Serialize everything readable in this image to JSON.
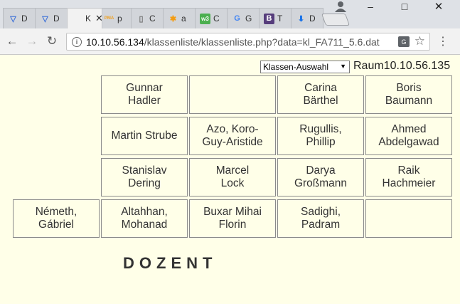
{
  "browser": {
    "tabs": [
      {
        "title": "D",
        "icon": "vpn-icon",
        "color": "#3b6fd8",
        "glyph": "▽"
      },
      {
        "title": "D",
        "icon": "vpn-icon",
        "color": "#3b6fd8",
        "glyph": "▽"
      },
      {
        "title": "K",
        "icon": "page-icon",
        "color": "#777",
        "glyph": "",
        "active": true
      },
      {
        "title": "p",
        "icon": "phpmyadmin-icon",
        "color": "#f0a020",
        "glyph": "PMA"
      },
      {
        "title": "C",
        "icon": "page-icon",
        "color": "#777",
        "glyph": "▯"
      },
      {
        "title": "a",
        "icon": "asterisk-icon",
        "color": "#f39c12",
        "glyph": "✱"
      },
      {
        "title": "C",
        "icon": "w3schools-icon",
        "color": "#4caf50",
        "glyph": "w3"
      },
      {
        "title": "G",
        "icon": "google-icon",
        "color": "#4285f4",
        "glyph": "G"
      },
      {
        "title": "T",
        "icon": "bootstrap-icon",
        "color": "#563d7c",
        "glyph": "B"
      },
      {
        "title": "D",
        "icon": "download-icon",
        "color": "#1a73e8",
        "glyph": "⬇"
      }
    ],
    "url_host": "10.10.56.134",
    "url_path": "/klassenliste/klassenliste.php?data=kl_FA711_5.6.dat"
  },
  "page": {
    "select_value": "Klassen-Auswahl",
    "room_label": "Raum10.10.56.135",
    "dozent_label": "DOZENT",
    "seats": [
      {
        "row": 0,
        "col": 1,
        "name": "Gunnar\nHadler"
      },
      {
        "row": 0,
        "col": 2,
        "name": ""
      },
      {
        "row": 0,
        "col": 3,
        "name": "Carina\nBärthel"
      },
      {
        "row": 0,
        "col": 4,
        "name": "Boris\nBaumann"
      },
      {
        "row": 1,
        "col": 1,
        "name": "Martin Strube"
      },
      {
        "row": 1,
        "col": 2,
        "name": "Azo, Koro-\nGuy-Aristide"
      },
      {
        "row": 1,
        "col": 3,
        "name": "Rugullis,\nPhillip"
      },
      {
        "row": 1,
        "col": 4,
        "name": "Ahmed\nAbdelgawad"
      },
      {
        "row": 2,
        "col": 1,
        "name": "Stanislav\nDering"
      },
      {
        "row": 2,
        "col": 2,
        "name": "Marcel\nLock"
      },
      {
        "row": 2,
        "col": 3,
        "name": "Darya\nGroßmann"
      },
      {
        "row": 2,
        "col": 4,
        "name": "Raik\nHachmeier"
      },
      {
        "row": 3,
        "col": 0,
        "name": "Németh,\nGábriel"
      },
      {
        "row": 3,
        "col": 1,
        "name": "Altahhan,\nMohanad"
      },
      {
        "row": 3,
        "col": 2,
        "name": "Buxar Mihai\nFlorin"
      },
      {
        "row": 3,
        "col": 3,
        "name": "Sadighi,\nPadram"
      },
      {
        "row": 3,
        "col": 4,
        "name": ""
      }
    ]
  }
}
